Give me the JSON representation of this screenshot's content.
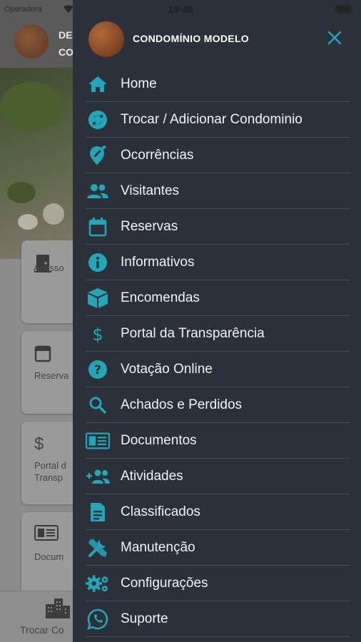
{
  "status_bar": {
    "carrier": "Operadora",
    "time": "19:46"
  },
  "background": {
    "header": {
      "line1": "DE",
      "line2": "CO"
    },
    "cards": [
      {
        "icon": "door-icon",
        "label": "Acesso"
      },
      {
        "icon": "calendar-icon",
        "label": "Reserva"
      },
      {
        "icon": "dollar-icon",
        "label": "Portal d\nTransp"
      },
      {
        "icon": "document-icon",
        "label": "Docum"
      }
    ],
    "bottom_tab": {
      "icon": "buildings-icon",
      "label": "Trocar Co"
    }
  },
  "drawer": {
    "title": "CONDOMÍNIO MODELO",
    "accent_color": "#24a5b8",
    "background_color": "#2c3038",
    "items": [
      {
        "icon": "home-icon",
        "label": "Home"
      },
      {
        "icon": "swap-icon",
        "label": "Trocar / Adicionar Condominio"
      },
      {
        "icon": "location-edit-icon",
        "label": "Ocorrências"
      },
      {
        "icon": "people-icon",
        "label": "Visitantes"
      },
      {
        "icon": "calendar-icon",
        "label": "Reservas"
      },
      {
        "icon": "info-icon",
        "label": "Informativos"
      },
      {
        "icon": "package-icon",
        "label": "Encomendas"
      },
      {
        "icon": "dollar-icon",
        "label": "Portal da Transparência"
      },
      {
        "icon": "help-icon",
        "label": "Votação Online"
      },
      {
        "icon": "search-icon",
        "label": "Achados e Perdidos"
      },
      {
        "icon": "document-icon",
        "label": "Documentos"
      },
      {
        "icon": "group-add-icon",
        "label": "Atividades"
      },
      {
        "icon": "classified-icon",
        "label": "Classificados"
      },
      {
        "icon": "tools-icon",
        "label": "Manutenção"
      },
      {
        "icon": "settings-icon",
        "label": "Configurações"
      },
      {
        "icon": "whatsapp-icon",
        "label": "Suporte"
      }
    ]
  }
}
